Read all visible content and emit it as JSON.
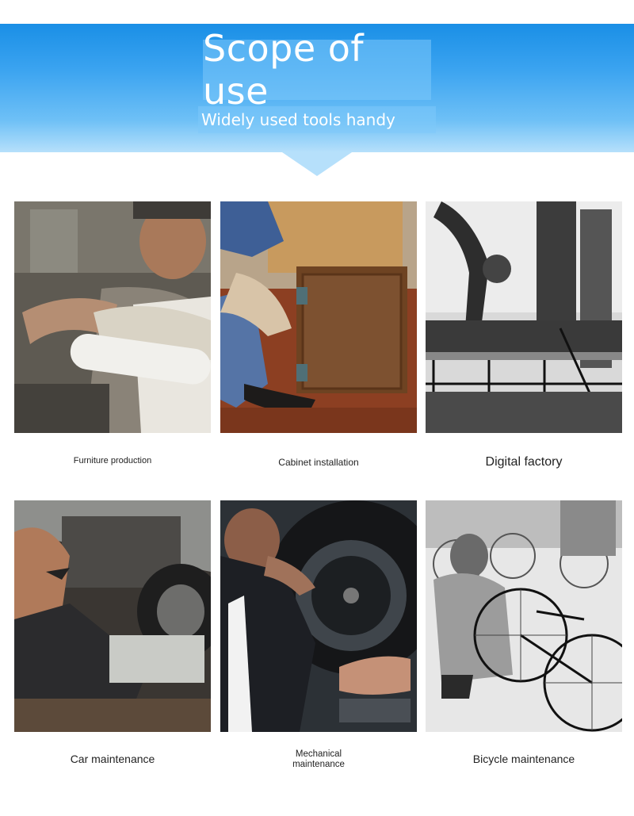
{
  "header": {
    "title": "Scope of use",
    "subtitle": "Widely used tools handy"
  },
  "scenes": [
    {
      "caption": "Furniture production",
      "image_icon": "woodworker-photo"
    },
    {
      "caption": "Cabinet installation",
      "image_icon": "cabinet-photo"
    },
    {
      "caption": "Digital factory",
      "image_icon": "factory-photo"
    },
    {
      "caption": "Car maintenance",
      "image_icon": "car-repair-photo"
    },
    {
      "caption_line1": "Mechanical",
      "caption_line2": "maintenance",
      "image_icon": "tire-repair-photo"
    },
    {
      "caption": "Bicycle maintenance",
      "image_icon": "bicycle-repair-photo"
    }
  ],
  "colors": {
    "banner_top": "#1a8fe6",
    "banner_bottom": "#b6e0fb",
    "text": "#222222"
  }
}
